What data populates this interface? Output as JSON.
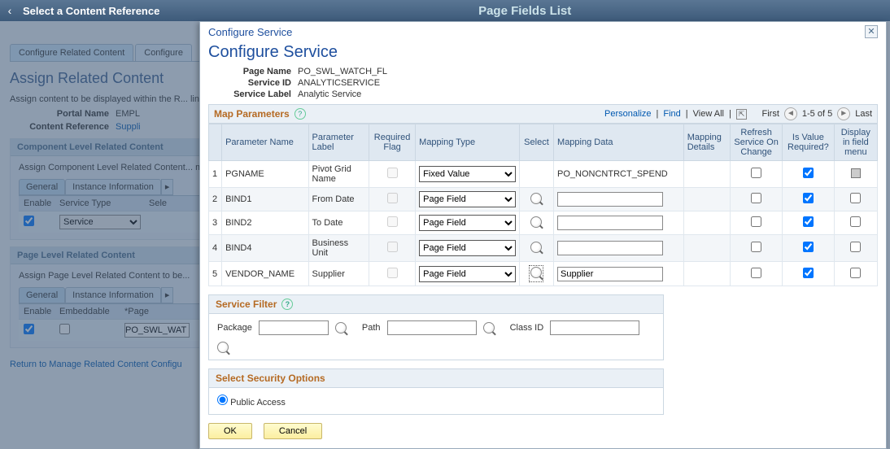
{
  "top": {
    "back_label": "Select a Content Reference",
    "center": "Page Fields List"
  },
  "bg": {
    "tabs": [
      "Configure Related Content",
      "Configure"
    ],
    "h1": "Assign Related Content",
    "desc": "Assign content to be displayed within the R... link to define the parameter mappings and ...",
    "kv": [
      {
        "k": "Portal Name",
        "v": "EMPL"
      },
      {
        "k": "Content Reference",
        "v": "Suppli"
      }
    ],
    "comp": {
      "title": "Component Level Related Content",
      "body": "Assign Component Level Related Content... menu.",
      "subtabs": [
        "General",
        "Instance Information"
      ],
      "grid_head": [
        "Enable",
        "Service Type",
        "Sele"
      ],
      "row0": {
        "enable": true,
        "service_type": "Service"
      }
    },
    "page": {
      "title": "Page Level Related Content",
      "body": "Assign Page Level Related Content to be...",
      "subtabs": [
        "General",
        "Instance Information"
      ],
      "grid_head": [
        "Enable",
        "Embeddable",
        "*Page"
      ],
      "row0": {
        "enable": true,
        "embeddable": false,
        "page": "PO_SWL_WAT"
      }
    },
    "return_link": "Return to Manage Related Content Configu"
  },
  "modal": {
    "bar": "Configure Service",
    "h1": "Configure Service",
    "kv": [
      {
        "k": "Page Name",
        "v": "PO_SWL_WATCH_FL"
      },
      {
        "k": "Service ID",
        "v": "ANALYTICSERVICE"
      },
      {
        "k": "Service Label",
        "v": "Analytic Service"
      }
    ],
    "map": {
      "title": "Map Parameters",
      "links": {
        "personalize": "Personalize",
        "find": "Find",
        "viewall": "View All"
      },
      "nav": {
        "first": "First",
        "range": "1-5 of 5",
        "last": "Last"
      },
      "cols": [
        "",
        "Parameter Name",
        "Parameter Label",
        "Required Flag",
        "Mapping Type",
        "Select",
        "Mapping Data",
        "Mapping Details",
        "Refresh Service On Change",
        "Is Value Required?",
        "Display in field menu"
      ],
      "rows": [
        {
          "n": "1",
          "name": "PGNAME",
          "label": "Pivot Grid Name",
          "req": false,
          "type": "Fixed Value",
          "select": false,
          "data": "PO_NONCNTRCT_SPEND",
          "refresh": false,
          "isreq": true,
          "disp": "disabled"
        },
        {
          "n": "2",
          "name": "BIND1",
          "label": "From Date",
          "req": false,
          "type": "Page Field",
          "select": true,
          "data": "",
          "refresh": false,
          "isreq": true,
          "disp": false
        },
        {
          "n": "3",
          "name": "BIND2",
          "label": "To Date",
          "req": false,
          "type": "Page Field",
          "select": true,
          "data": "",
          "refresh": false,
          "isreq": true,
          "disp": false
        },
        {
          "n": "4",
          "name": "BIND4",
          "label": "Business Unit",
          "req": false,
          "type": "Page Field",
          "select": true,
          "data": "",
          "refresh": false,
          "isreq": true,
          "disp": false
        },
        {
          "n": "5",
          "name": "VENDOR_NAME",
          "label": "Supplier",
          "req": false,
          "type": "Page Field",
          "select": true,
          "data": "Supplier",
          "refresh": false,
          "isreq": true,
          "disp": false,
          "select_boxed": true
        }
      ]
    },
    "filter": {
      "title": "Service Filter",
      "package": "Package",
      "path": "Path",
      "classid": "Class ID"
    },
    "security": {
      "title": "Select Security Options",
      "public": "Public Access"
    },
    "buttons": {
      "ok": "OK",
      "cancel": "Cancel"
    }
  }
}
